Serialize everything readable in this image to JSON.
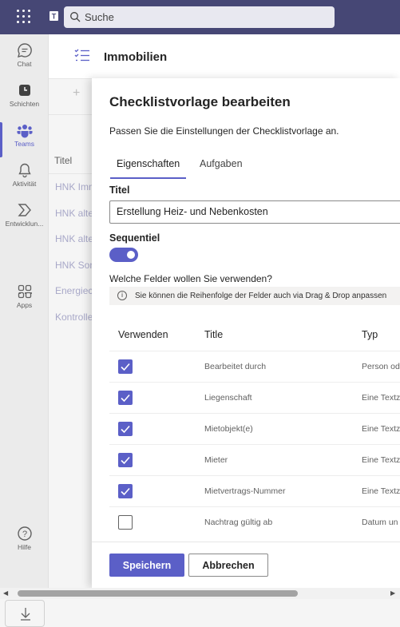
{
  "search": {
    "placeholder": "Suche"
  },
  "rail": {
    "items": [
      {
        "label": "Chat",
        "icon": "chat-icon"
      },
      {
        "label": "Schichten",
        "icon": "shifts-icon"
      },
      {
        "label": "Teams",
        "icon": "teams-icon",
        "active": true
      },
      {
        "label": "Aktivität",
        "icon": "bell-icon"
      },
      {
        "label": "Entwicklun...",
        "icon": "developer-icon"
      },
      {
        "label": "Apps",
        "icon": "apps-icon"
      },
      {
        "label": "Hilfe",
        "icon": "help-icon"
      }
    ],
    "more": "···"
  },
  "app": {
    "title": "Immobilien"
  },
  "background_list": {
    "new": "+",
    "header": "Titel",
    "rows": [
      "HNK Imm",
      "HNK alte",
      "HNK alte",
      "HNK Son",
      "Energiec",
      "Kontrolle"
    ]
  },
  "panel": {
    "title": "Checklistvorlage bearbeiten",
    "description": "Passen Sie die Einstellungen der Checklistvorlage an.",
    "tabs": [
      {
        "label": "Eigenschaften",
        "active": true
      },
      {
        "label": "Aufgaben",
        "active": false
      }
    ],
    "title_label": "Titel",
    "title_value": "Erstellung Heiz- und Nebenkosten",
    "sequential_label": "Sequentiel",
    "sequential_on": true,
    "fields_question": "Welche Felder wollen Sie verwenden?",
    "info_text": "Sie können die Reihenfolge der Felder auch via Drag & Drop anpassen",
    "columns": {
      "use": "Verwenden",
      "title": "Title",
      "type": "Typ"
    },
    "rows": [
      {
        "title": "Bearbeitet durch",
        "type": "Person od",
        "checked": true
      },
      {
        "title": "Liegenschaft",
        "type": "Eine Textz",
        "checked": true
      },
      {
        "title": "Mietobjekt(e)",
        "type": "Eine Textz",
        "checked": true
      },
      {
        "title": "Mieter",
        "type": "Eine Textz",
        "checked": true
      },
      {
        "title": "Mietvertrags-Nummer",
        "type": "Eine Textz",
        "checked": true
      },
      {
        "title": "Nachtrag gültig ab",
        "type": "Datum un",
        "checked": false
      }
    ],
    "save": "Speichern",
    "cancel": "Abbrechen"
  },
  "colors": {
    "accent": "#5b5fc7",
    "topbar": "#464775"
  }
}
